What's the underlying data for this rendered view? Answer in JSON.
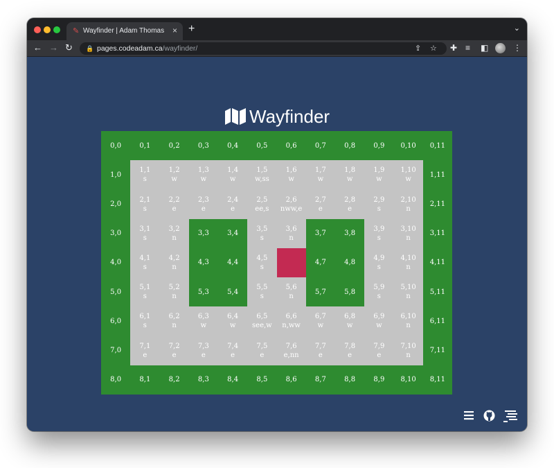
{
  "browser": {
    "tab_title": "Wayfinder | Adam Thomas",
    "url_host": "pages.codeadam.ca",
    "url_path": "/wayfinder/",
    "new_tab_label": "+",
    "close_label": "×"
  },
  "page": {
    "title": "Wayfinder"
  },
  "grid": {
    "rows": 9,
    "cols": 12,
    "colors": {
      "wall": "#2e8b30",
      "open": "#c4c4c4",
      "goal": "#c32a52",
      "background": "#2b4267"
    },
    "cells": [
      [
        {
          "c": "0,0",
          "t": "wall"
        },
        {
          "c": "0,1",
          "t": "wall"
        },
        {
          "c": "0,2",
          "t": "wall"
        },
        {
          "c": "0,3",
          "t": "wall"
        },
        {
          "c": "0,4",
          "t": "wall"
        },
        {
          "c": "0,5",
          "t": "wall"
        },
        {
          "c": "0,6",
          "t": "wall"
        },
        {
          "c": "0,7",
          "t": "wall"
        },
        {
          "c": "0,8",
          "t": "wall"
        },
        {
          "c": "0,9",
          "t": "wall"
        },
        {
          "c": "0,10",
          "t": "wall"
        },
        {
          "c": "0,11",
          "t": "wall"
        }
      ],
      [
        {
          "c": "1,0",
          "t": "wall"
        },
        {
          "c": "1,1",
          "d": "s",
          "t": "open"
        },
        {
          "c": "1,2",
          "d": "w",
          "t": "open"
        },
        {
          "c": "1,3",
          "d": "w",
          "t": "open"
        },
        {
          "c": "1,4",
          "d": "w",
          "t": "open"
        },
        {
          "c": "1,5",
          "d": "w,ss",
          "t": "open"
        },
        {
          "c": "1,6",
          "d": "w",
          "t": "open"
        },
        {
          "c": "1,7",
          "d": "w",
          "t": "open"
        },
        {
          "c": "1,8",
          "d": "w",
          "t": "open"
        },
        {
          "c": "1,9",
          "d": "w",
          "t": "open"
        },
        {
          "c": "1,10",
          "d": "w",
          "t": "open"
        },
        {
          "c": "1,11",
          "t": "wall"
        }
      ],
      [
        {
          "c": "2,0",
          "t": "wall"
        },
        {
          "c": "2,1",
          "d": "s",
          "t": "open"
        },
        {
          "c": "2,2",
          "d": "e",
          "t": "open"
        },
        {
          "c": "2,3",
          "d": "e",
          "t": "open"
        },
        {
          "c": "2,4",
          "d": "e",
          "t": "open"
        },
        {
          "c": "2,5",
          "d": "ee,s",
          "t": "open"
        },
        {
          "c": "2,6",
          "d": "nww,e",
          "t": "open"
        },
        {
          "c": "2,7",
          "d": "e",
          "t": "open"
        },
        {
          "c": "2,8",
          "d": "e",
          "t": "open"
        },
        {
          "c": "2,9",
          "d": "s",
          "t": "open"
        },
        {
          "c": "2,10",
          "d": "n",
          "t": "open"
        },
        {
          "c": "2,11",
          "t": "wall"
        }
      ],
      [
        {
          "c": "3,0",
          "t": "wall"
        },
        {
          "c": "3,1",
          "d": "s",
          "t": "open"
        },
        {
          "c": "3,2",
          "d": "n",
          "t": "open"
        },
        {
          "c": "3,3",
          "t": "wall"
        },
        {
          "c": "3,4",
          "t": "wall"
        },
        {
          "c": "3,5",
          "d": "s",
          "t": "open"
        },
        {
          "c": "3,6",
          "d": "n",
          "t": "open"
        },
        {
          "c": "3,7",
          "t": "wall"
        },
        {
          "c": "3,8",
          "t": "wall"
        },
        {
          "c": "3,9",
          "d": "s",
          "t": "open"
        },
        {
          "c": "3,10",
          "d": "n",
          "t": "open"
        },
        {
          "c": "3,11",
          "t": "wall"
        }
      ],
      [
        {
          "c": "4,0",
          "t": "wall"
        },
        {
          "c": "4,1",
          "d": "s",
          "t": "open"
        },
        {
          "c": "4,2",
          "d": "n",
          "t": "open"
        },
        {
          "c": "4,3",
          "t": "wall"
        },
        {
          "c": "4,4",
          "t": "wall"
        },
        {
          "c": "4,5",
          "d": "s",
          "t": "open"
        },
        {
          "c": "",
          "t": "goal"
        },
        {
          "c": "4,7",
          "t": "wall"
        },
        {
          "c": "4,8",
          "t": "wall"
        },
        {
          "c": "4,9",
          "d": "s",
          "t": "open"
        },
        {
          "c": "4,10",
          "d": "n",
          "t": "open"
        },
        {
          "c": "4,11",
          "t": "wall"
        }
      ],
      [
        {
          "c": "5,0",
          "t": "wall"
        },
        {
          "c": "5,1",
          "d": "s",
          "t": "open"
        },
        {
          "c": "5,2",
          "d": "n",
          "t": "open"
        },
        {
          "c": "5,3",
          "t": "wall"
        },
        {
          "c": "5,4",
          "t": "wall"
        },
        {
          "c": "5,5",
          "d": "s",
          "t": "open"
        },
        {
          "c": "5,6",
          "d": "n",
          "t": "open"
        },
        {
          "c": "5,7",
          "t": "wall"
        },
        {
          "c": "5,8",
          "t": "wall"
        },
        {
          "c": "5,9",
          "d": "s",
          "t": "open"
        },
        {
          "c": "5,10",
          "d": "n",
          "t": "open"
        },
        {
          "c": "5,11",
          "t": "wall"
        }
      ],
      [
        {
          "c": "6,0",
          "t": "wall"
        },
        {
          "c": "6,1",
          "d": "s",
          "t": "open"
        },
        {
          "c": "6,2",
          "d": "n",
          "t": "open"
        },
        {
          "c": "6,3",
          "d": "w",
          "t": "open"
        },
        {
          "c": "6,4",
          "d": "w",
          "t": "open"
        },
        {
          "c": "6,5",
          "d": "see,w",
          "t": "open"
        },
        {
          "c": "6,6",
          "d": "n,ww",
          "t": "open"
        },
        {
          "c": "6,7",
          "d": "w",
          "t": "open"
        },
        {
          "c": "6,8",
          "d": "w",
          "t": "open"
        },
        {
          "c": "6,9",
          "d": "w",
          "t": "open"
        },
        {
          "c": "6,10",
          "d": "n",
          "t": "open"
        },
        {
          "c": "6,11",
          "t": "wall"
        }
      ],
      [
        {
          "c": "7,0",
          "t": "wall"
        },
        {
          "c": "7,1",
          "d": "e",
          "t": "open"
        },
        {
          "c": "7,2",
          "d": "e",
          "t": "open"
        },
        {
          "c": "7,3",
          "d": "e",
          "t": "open"
        },
        {
          "c": "7,4",
          "d": "e",
          "t": "open"
        },
        {
          "c": "7,5",
          "d": "e",
          "t": "open"
        },
        {
          "c": "7,6",
          "d": "e,nn",
          "t": "open"
        },
        {
          "c": "7,7",
          "d": "e",
          "t": "open"
        },
        {
          "c": "7,8",
          "d": "e",
          "t": "open"
        },
        {
          "c": "7,9",
          "d": "e",
          "t": "open"
        },
        {
          "c": "7,10",
          "d": "n",
          "t": "open"
        },
        {
          "c": "7,11",
          "t": "wall"
        }
      ],
      [
        {
          "c": "8,0",
          "t": "wall"
        },
        {
          "c": "8,1",
          "t": "wall"
        },
        {
          "c": "8,2",
          "t": "wall"
        },
        {
          "c": "8,3",
          "t": "wall"
        },
        {
          "c": "8,4",
          "t": "wall"
        },
        {
          "c": "8,5",
          "t": "wall"
        },
        {
          "c": "8,6",
          "t": "wall"
        },
        {
          "c": "8,7",
          "t": "wall"
        },
        {
          "c": "8,8",
          "t": "wall"
        },
        {
          "c": "8,9",
          "t": "wall"
        },
        {
          "c": "8,10",
          "t": "wall"
        },
        {
          "c": "8,11",
          "t": "wall"
        }
      ]
    ]
  },
  "icons": {
    "back": "arrow-left-icon",
    "forward": "arrow-right-icon",
    "reload": "reload-icon",
    "lock": "lock-icon",
    "share": "share-icon",
    "bookmark": "star-icon",
    "extensions": "puzzle-icon",
    "media": "playlist-icon",
    "sidepanel": "sidepanel-icon",
    "menu": "kebab-menu-icon",
    "footer": [
      "hamburger-menu-icon",
      "github-icon",
      "codeadam-logo-icon"
    ]
  }
}
